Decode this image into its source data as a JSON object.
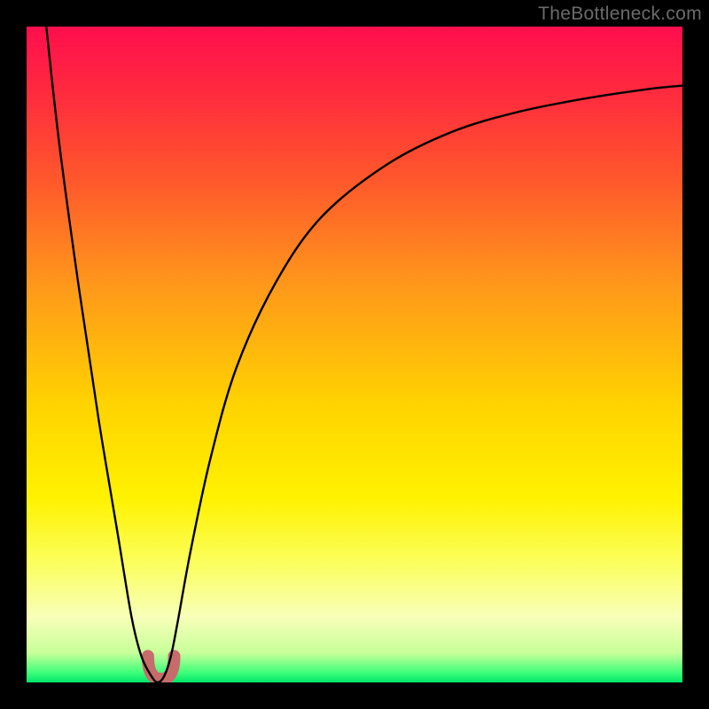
{
  "watermark": "TheBottleneck.com",
  "gradient": {
    "stops": [
      {
        "offset": 0.0,
        "color": "#ff0e4e"
      },
      {
        "offset": 0.1,
        "color": "#ff2a3e"
      },
      {
        "offset": 0.24,
        "color": "#ff5a2b"
      },
      {
        "offset": 0.4,
        "color": "#ff9a1a"
      },
      {
        "offset": 0.58,
        "color": "#ffd400"
      },
      {
        "offset": 0.72,
        "color": "#fff200"
      },
      {
        "offset": 0.82,
        "color": "#fbff60"
      },
      {
        "offset": 0.9,
        "color": "#f8ffb8"
      },
      {
        "offset": 0.955,
        "color": "#c8ff9a"
      },
      {
        "offset": 0.985,
        "color": "#3eff7a"
      },
      {
        "offset": 1.0,
        "color": "#00e66a"
      }
    ]
  },
  "chart_data": {
    "type": "line",
    "title": "",
    "xlabel": "",
    "ylabel": "",
    "xlim": [
      0,
      100
    ],
    "ylim": [
      0,
      100
    ],
    "series": [
      {
        "name": "bottleneck-curve",
        "x": [
          3,
          5,
          8,
          11,
          14,
          16,
          17.5,
          19,
          20,
          21,
          22,
          23,
          25,
          28,
          32,
          38,
          45,
          55,
          65,
          75,
          85,
          95,
          100
        ],
        "y": [
          100,
          82,
          60,
          40,
          22,
          10,
          4,
          1,
          0,
          1,
          4,
          9,
          20,
          34,
          48,
          61,
          71,
          79,
          84,
          87,
          89,
          90.5,
          91
        ]
      }
    ],
    "annotations": [
      {
        "name": "bottleneck-marker",
        "x_range": [
          18.5,
          22.5
        ],
        "y_range": [
          0,
          4
        ],
        "color": "#c76b6b"
      }
    ]
  }
}
